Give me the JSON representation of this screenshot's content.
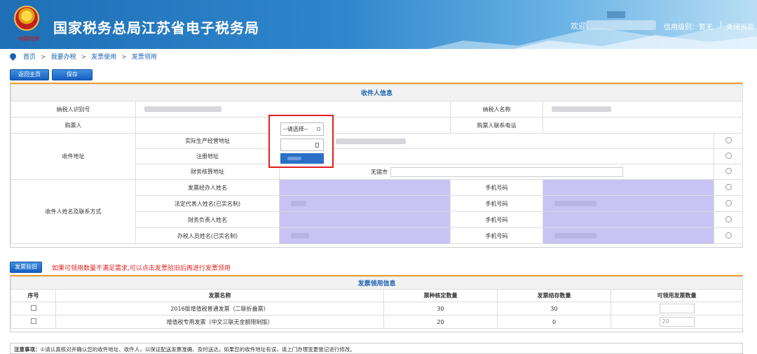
{
  "header": {
    "title": "国家税务总局江苏省电子税务局",
    "subtitle": "中国税务",
    "welcome": "欢迎,",
    "credit": "信用级别：暂无",
    "separator": "|",
    "close": "关闭当前"
  },
  "breadcrumb": {
    "items": [
      "首页",
      "我要办税",
      "发票使用",
      "发票领用"
    ],
    "sep": ">"
  },
  "toolbar": {
    "back": "返回主页",
    "save": "保存"
  },
  "recipient": {
    "section_title": "收件人信息",
    "taxpayer_id_label": "纳税人识别号",
    "taxpayer_name_label": "纳税人名称",
    "buyer_label": "购票人",
    "buyer_phone_label": "购票人联系电话",
    "address_group_label": "收件地址",
    "addresses": [
      {
        "label": "实际生产经营地址"
      },
      {
        "label": "注册地址"
      },
      {
        "label": "财务核算地址",
        "city": "无锡市"
      }
    ],
    "contact_group_label": "收件人姓名及联系方式",
    "contacts": [
      {
        "label": "发票经办人姓名",
        "phone_label": "手机号码"
      },
      {
        "label": "法定代表人姓名(已实名制)",
        "phone_label": "手机号码"
      },
      {
        "label": "财务负责人姓名",
        "phone_label": "手机号码"
      },
      {
        "label": "办税人员姓名(已实名制)",
        "phone_label": "手机号码"
      }
    ]
  },
  "popup": {
    "select_placeholder": "--请选择--"
  },
  "verify": {
    "button": "发票验旧",
    "note": "如果可领用数量不满足需求,可以点击发票验旧后再进行发票领用"
  },
  "invoice": {
    "section_title": "发票领用信息",
    "headers": [
      "序号",
      "发票名称",
      "票种核定数量",
      "发票结存数量",
      "可领用发票数量"
    ],
    "rows": [
      {
        "name": "2016版增值税普通发票（二联折叠票）",
        "approved": "30",
        "stock": "30",
        "receivable": ""
      },
      {
        "name": "增值税专用发票（中文三联无金额限制版）",
        "approved": "20",
        "stock": "0",
        "receivable": "20"
      }
    ]
  },
  "notice": {
    "label": "注意事项：",
    "text": "①请认真核对并确认您的收件地址、收件人，以保证配送发票准确、及时送达。如果您的收件地址有误，请上门办理变更登记进行修改。"
  }
}
